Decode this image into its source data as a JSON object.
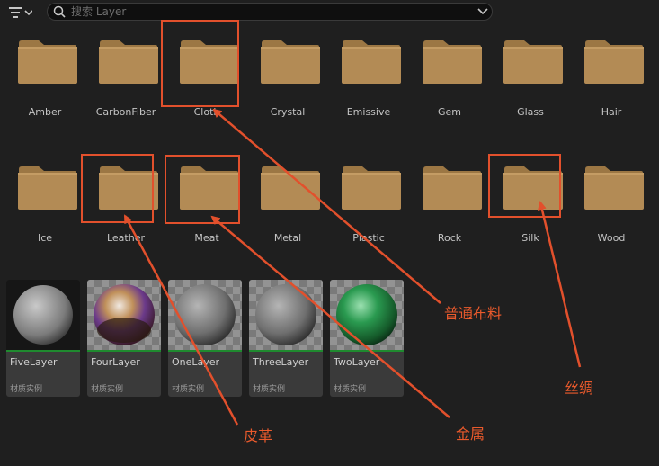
{
  "toolbar": {
    "filter_icon": "filter-icon",
    "search": {
      "placeholder": "搜索 Layer",
      "value": ""
    }
  },
  "folders": [
    {
      "label": "Amber"
    },
    {
      "label": "CarbonFiber"
    },
    {
      "label": "Cloth"
    },
    {
      "label": "Crystal"
    },
    {
      "label": "Emissive"
    },
    {
      "label": "Gem"
    },
    {
      "label": "Glass"
    },
    {
      "label": "Hair"
    },
    {
      "label": "Ice"
    },
    {
      "label": "Leather"
    },
    {
      "label": "Meat"
    },
    {
      "label": "Metal"
    },
    {
      "label": "Plastic"
    },
    {
      "label": "Rock"
    },
    {
      "label": "Silk"
    },
    {
      "label": "Wood"
    }
  ],
  "assets": [
    {
      "name": "FiveLayer",
      "type": "材质实例"
    },
    {
      "name": "FourLayer",
      "type": "材质实例"
    },
    {
      "name": "OneLayer",
      "type": "材质实例"
    },
    {
      "name": "ThreeLayer",
      "type": "材质实例"
    },
    {
      "name": "TwoLayer",
      "type": "材质实例"
    }
  ],
  "annotations": {
    "cloth": "普通布料",
    "silk": "丝绸",
    "leather": "皮革",
    "metal": "金属"
  },
  "colors": {
    "background": "#1f1f1f",
    "folder": "#b38b55",
    "annotation": "#e2502c",
    "asset_bar": "#1f8a2f"
  }
}
